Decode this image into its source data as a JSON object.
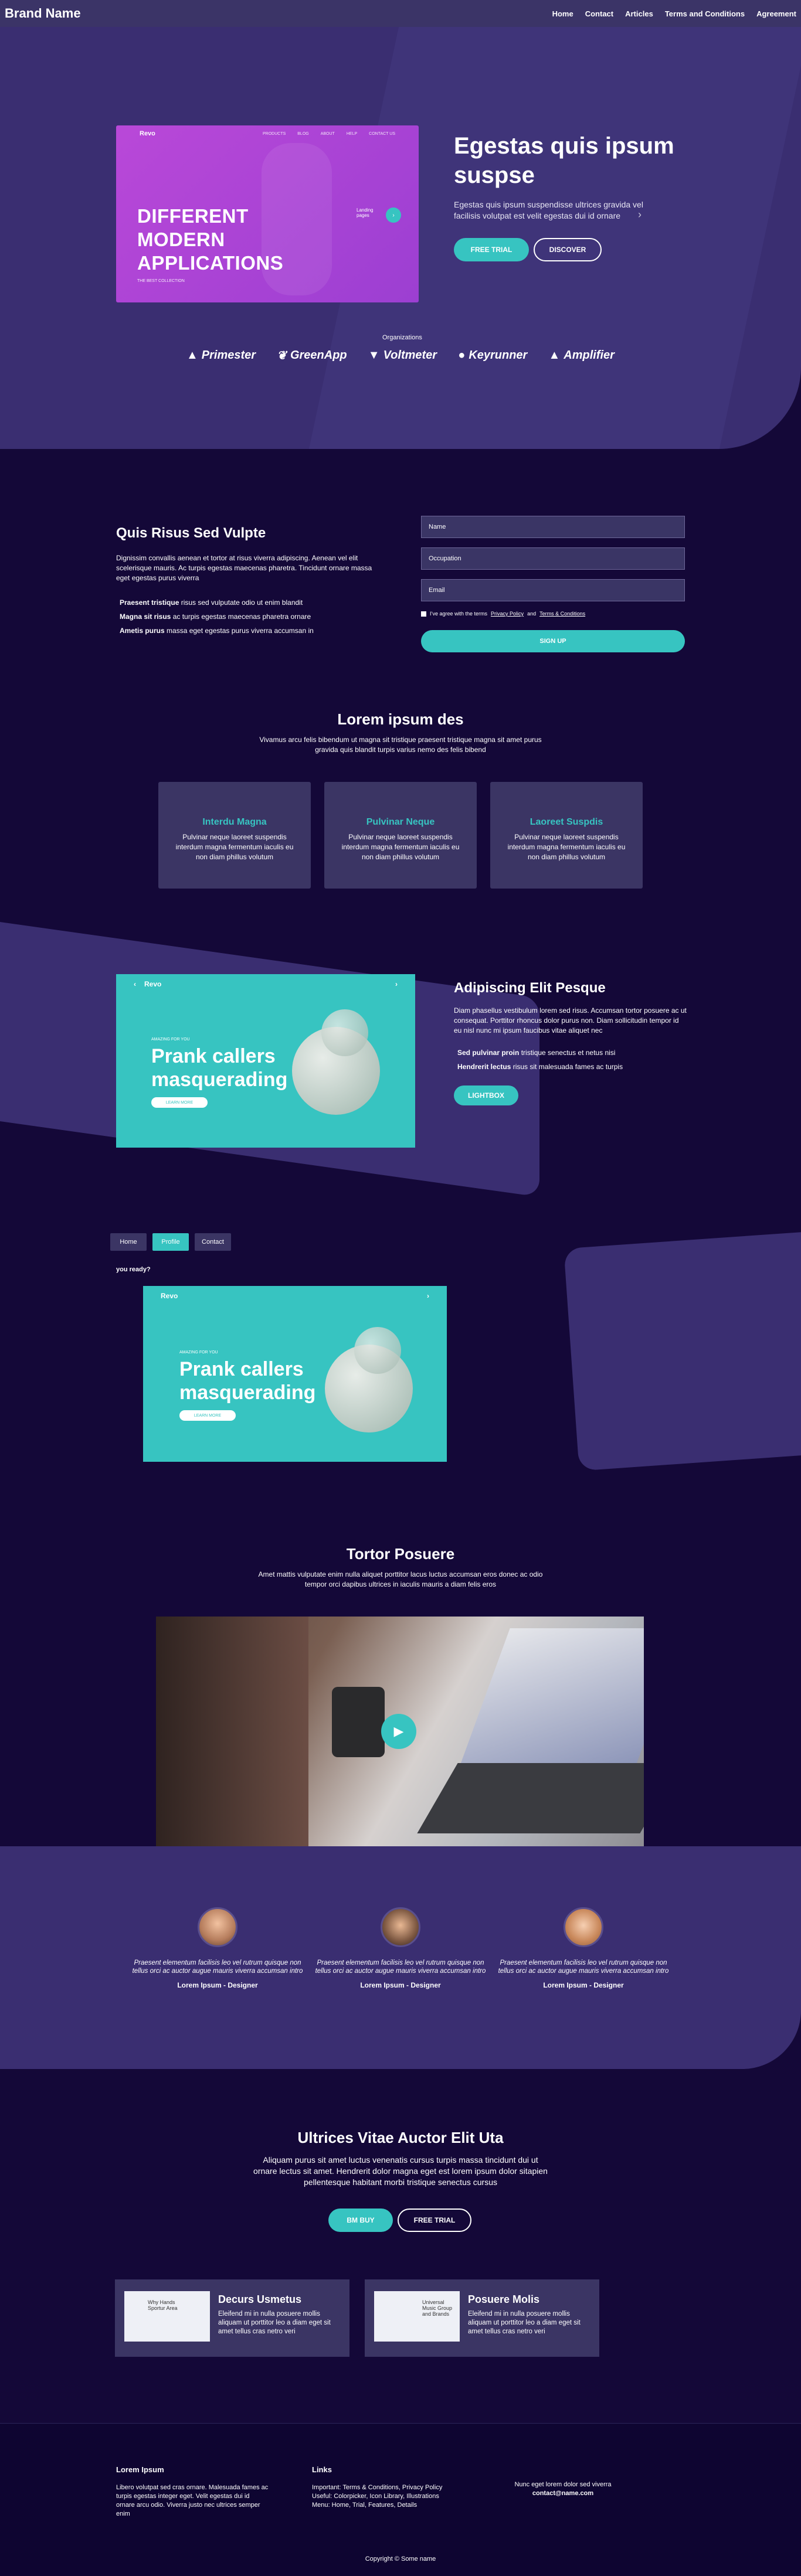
{
  "nav": {
    "brand": "Brand Name",
    "links": [
      "Home",
      "Contact",
      "Articles",
      "Terms and Conditions",
      "Agreement"
    ]
  },
  "hero": {
    "mock": {
      "brand": "Revo",
      "nav": [
        "PRODUCTS",
        "BLOG",
        "ABOUT",
        "HELP",
        "CONTACT US"
      ],
      "headline": [
        "DIFFERENT",
        "MODERN",
        "APPLICATIONS"
      ],
      "tag": "THE BEST COLLECTION",
      "side": "Landing pages"
    },
    "title": "Egestas quis ipsum suspse",
    "subtitle": "Egestas quis ipsum suspendisse ultrices gravida vel facilisis volutpat est velit egestas dui id ornare",
    "btn_primary": "FREE TRIAL",
    "btn_secondary": "DISCOVER",
    "logos_label": "Organizations",
    "logos": [
      "Primester",
      "GreenApp",
      "Voltmeter",
      "Keyrunner",
      "Amplifier"
    ]
  },
  "signup": {
    "title": "Quis Risus Sed Vulpte",
    "text": "Dignissim convallis aenean et tortor at risus viverra adipiscing. Aenean vel elit scelerisque mauris. Ac turpis egestas maecenas pharetra. Tincidunt ornare massa eget egestas purus viverra",
    "list": [
      {
        "b": "Praesent tristique",
        "t": " risus sed vulputate odio ut enim blandit"
      },
      {
        "b": "Magna sit risus",
        "t": " ac turpis egestas maecenas pharetra ornare"
      },
      {
        "b": "Ametis purus",
        "t": " massa eget egestas purus viverra accumsan in"
      }
    ],
    "fields": {
      "name": "Name",
      "occupation": "Occupation",
      "email": "Email"
    },
    "check_pre": "I’ve agree with the terms",
    "privacy": "Privacy Policy",
    "and": " and ",
    "terms": "Terms & Conditions",
    "button": "SIGN UP"
  },
  "features": {
    "title": "Lorem ipsum des",
    "subtitle": "Vivamus arcu felis bibendum ut magna sit tristique praesent tristique magna sit amet purus gravida quis blandit turpis varius nemo des felis bibend",
    "cards": [
      {
        "title": "Interdu Magna",
        "text": "Pulvinar neque laoreet suspendis interdum magna fermentum iaculis eu non diam phillus volutum"
      },
      {
        "title": "Pulvinar Neque",
        "text": "Pulvinar neque laoreet suspendis interdum magna fermentum iaculis eu non diam phillus volutum"
      },
      {
        "title": "Laoreet Suspdis",
        "text": "Pulvinar neque laoreet suspendis interdum magna fermentum iaculis eu non diam phillus volutum"
      }
    ]
  },
  "details": {
    "mock": {
      "brand": "Revo",
      "kicker": "AMAZING FOR YOU",
      "headline": [
        "Prank callers",
        "masquerading"
      ],
      "btn": "LEARN MORE"
    },
    "title": "Adipiscing Elit Pesque",
    "text": "Diam phasellus vestibulum lorem sed risus. Accumsan tortor posuere ac ut consequat. Porttitor rhoncus dolor purus non. Diam sollicitudin tempor id eu nisl nunc mi ipsum faucibus vitae aliquet nec",
    "list": [
      {
        "b": "Sed pulvinar proin",
        "t": " tristique senectus et netus nisi"
      },
      {
        "b": "Hendrerit lectus",
        "t": " risus sit malesuada fames ac turpis"
      }
    ],
    "button": "LIGHTBOX"
  },
  "tabs": {
    "items": [
      "Home",
      "Profile",
      "Contact"
    ],
    "active": 1,
    "caption": "you ready?",
    "mock": {
      "brand": "Revo",
      "kicker": "AMAZING FOR YOU",
      "headline": [
        "Prank callers",
        "masquerading"
      ],
      "btn": "LEARN MORE"
    }
  },
  "video": {
    "title": "Tortor Posuere",
    "subtitle": "Amet mattis vulputate enim nulla aliquet porttitor lacus luctus accumsan eros donec ac odio tempor orci dapibus ultrices in iaculis mauris a diam felis eros"
  },
  "testimonials": [
    {
      "quote": "Praesent elementum facilisis leo vel rutrum quisque non tellus orci ac auctor augue mauris viverra accumsan intro",
      "name": "Lorem Ipsum - Designer"
    },
    {
      "quote": "Praesent elementum facilisis leo vel rutrum quisque non tellus orci ac auctor augue mauris viverra accumsan intro",
      "name": "Lorem Ipsum - Designer"
    },
    {
      "quote": "Praesent elementum facilisis leo vel rutrum quisque non tellus orci ac auctor augue mauris viverra accumsan intro",
      "name": "Lorem Ipsum - Designer"
    }
  ],
  "cta": {
    "title": "Ultrices Vitae Auctor Elit Uta",
    "subtitle": "Aliquam purus sit amet luctus venenatis cursus turpis massa tincidunt dui ut ornare lectus sit amet. Hendrerit dolor magna eget est lorem ipsum dolor sitapien pellentesque habitant morbi tristique senectus cursus",
    "btn_primary": "BM BUY",
    "btn_secondary": "FREE TRIAL"
  },
  "resources": [
    {
      "title": "Decurs Usmetus",
      "text": "Eleifend mi in nulla posuere mollis aliquam ut porttitor leo a diam eget sit amet tellus cras netro veri",
      "thumb": "Why Hands Sportur Area"
    },
    {
      "title": "Posuere Molis",
      "text": "Eleifend mi in nulla posuere mollis aliquam ut porttitor leo a diam eget sit amet tellus cras netro veri",
      "thumb": "Universal Music Group and Brands"
    }
  ],
  "footer": {
    "col1": {
      "title": "Lorem Ipsum",
      "text": "Libero volutpat sed cras ornare. Malesuada fames ac turpis egestas integer eget. Velit egestas dui id ornare arcu odio. Viverra justo nec ultrices semper enim"
    },
    "col2": {
      "title": "Links",
      "lines": [
        "Important: Terms & Conditions, Privacy Policy",
        "Useful: Colorpicker, Icon Library, Illustrations",
        "Menu: Home, Trial, Features, Details"
      ]
    },
    "col3": {
      "text": "Nunc eget lorem dolor sed viverra",
      "email": "contact@name.com"
    },
    "copyright": "Copyright © Some name"
  },
  "colors": {
    "accent": "#37c4c1",
    "bg": "#140838",
    "band": "#3a2e71",
    "card": "#3b3564"
  }
}
